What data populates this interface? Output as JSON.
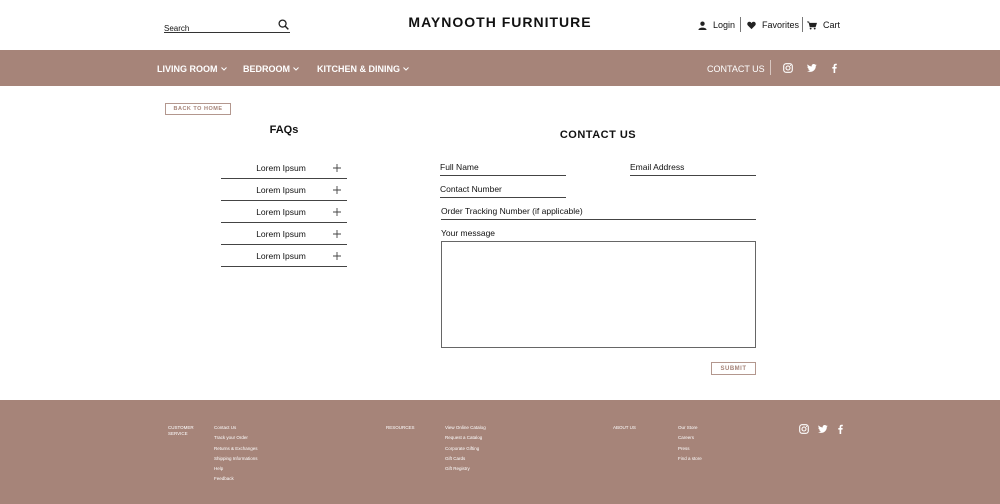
{
  "header": {
    "search_placeholder": "Search",
    "brand": "MAYNOOTH FURNITURE",
    "login_label": "Login",
    "favorites_label": "Favorites",
    "cart_label": "Cart"
  },
  "nav": {
    "items": [
      {
        "label": "LIVING ROOM"
      },
      {
        "label": "BEDROOM"
      },
      {
        "label": "KITCHEN & DINING"
      }
    ],
    "contact_label": "CONTACT US",
    "social_icons": [
      "instagram-icon",
      "twitter-icon",
      "facebook-icon"
    ]
  },
  "main": {
    "back_label": "BACK TO HOME",
    "faq_title": "FAQs",
    "faq_items": [
      {
        "label": "Lorem Ipsum"
      },
      {
        "label": "Lorem Ipsum"
      },
      {
        "label": "Lorem Ipsum"
      },
      {
        "label": "Lorem Ipsum"
      },
      {
        "label": "Lorem Ipsum"
      }
    ],
    "contact_title": "CONTACT US",
    "form": {
      "full_name": "Full Name",
      "email": "Email Address",
      "contact_number": "Contact Number",
      "order_tracking": "Order Tracking Number (if applicable)",
      "message": "Your message",
      "submit_label": "SUBMIT"
    }
  },
  "footer": {
    "customer_service": {
      "heading": "CUSTOMER SERVICE",
      "links": [
        "Contact Us",
        "Track your Order",
        "Returns & Exchanges",
        "Shipping Informations",
        "Help",
        "Feedback"
      ]
    },
    "resources": {
      "heading": "RESOURCES",
      "links": [
        "View Online Catalog",
        "Request a Catalog",
        "Corporate Gifting",
        "Gift Cards",
        "Gift Registry"
      ]
    },
    "about": {
      "heading": "ABOUT US",
      "links": [
        "Our Store",
        "Careers",
        "Press",
        "Find a store"
      ]
    }
  },
  "colors": {
    "accent": "#a68479",
    "text": "#111111",
    "background": "#ffffff"
  }
}
